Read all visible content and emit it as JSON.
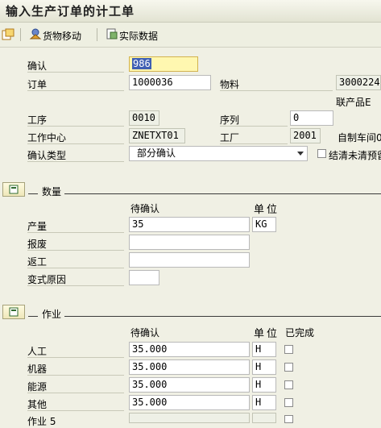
{
  "window": {
    "title": "输入生产订单的计工单"
  },
  "toolbar": {
    "goods_movement_label": "货物移动",
    "actual_data_label": "实际数据",
    "icons": [
      "document-icon",
      "goods-movement-icon",
      "actual-data-icon"
    ]
  },
  "header": {
    "confirm_label": "确认",
    "confirm_value": "986",
    "order_label": "订单",
    "order_value": "1000036",
    "material_label": "物料",
    "material_value": "3000224",
    "coproduct_label": "联产品E",
    "operation_label": "工序",
    "operation_value": "0010",
    "sequence_label": "序列",
    "sequence_value": "0",
    "workcenter_label": "工作中心",
    "workcenter_value": "ZNETXT01",
    "plant_label": "工厂",
    "plant_value": "2001",
    "inhouse_label": "自制车间0",
    "confirmtype_label": "确认类型",
    "confirmtype_value": "部分确认",
    "clear_open_label": "结清未清预留"
  },
  "quantity": {
    "section_label": "数量",
    "to_confirm_header": "待确认",
    "unit_header": "单位",
    "yield_label": "产量",
    "yield_value": "35",
    "yield_unit": "KG",
    "scrap_label": "报废",
    "rework_label": "返工",
    "variance_label": "变式原因"
  },
  "activity": {
    "section_label": "作业",
    "to_confirm_header": "待确认",
    "unit_header": "单位",
    "completed_header": "已完成",
    "rows": [
      {
        "label": "人工",
        "value": "35.000",
        "unit": "H"
      },
      {
        "label": "机器",
        "value": "35.000",
        "unit": "H"
      },
      {
        "label": "能源",
        "value": "35.000",
        "unit": "H"
      },
      {
        "label": "其他",
        "value": "35.000",
        "unit": "H"
      },
      {
        "label": "作业 5",
        "value": "",
        "unit": ""
      }
    ]
  }
}
